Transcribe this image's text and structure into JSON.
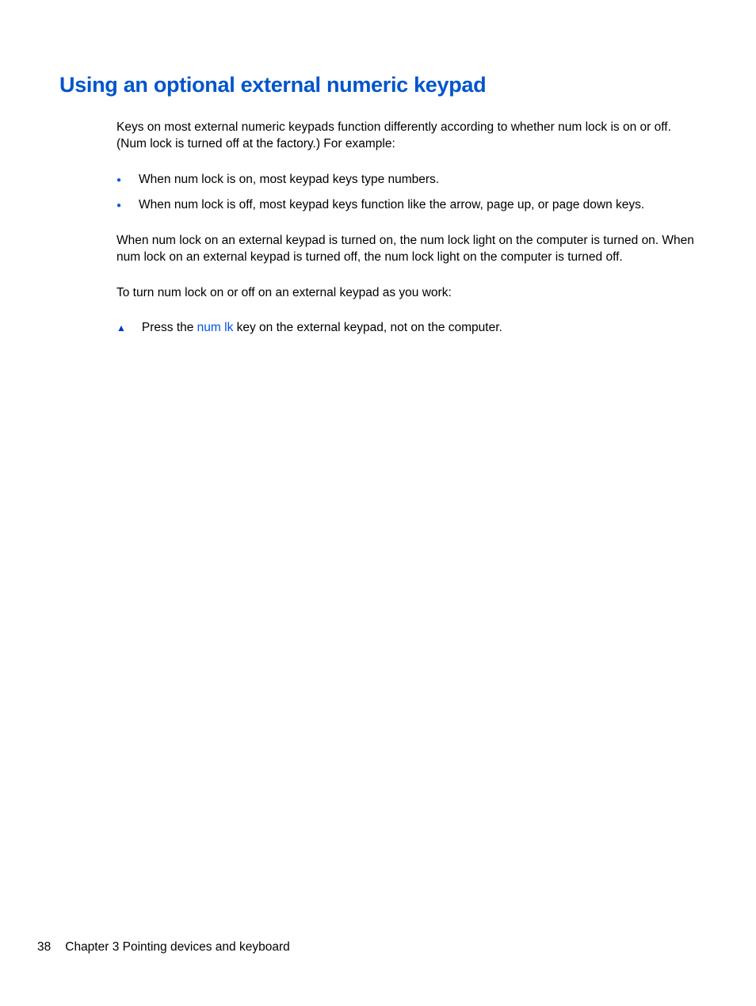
{
  "heading": "Using an optional external numeric keypad",
  "paragraph1": "Keys on most external numeric keypads function differently according to whether num lock is on or off. (Num lock is turned off at the factory.) For example:",
  "bullets": [
    "When num lock is on, most keypad keys type numbers.",
    "When num lock is off, most keypad keys function like the arrow, page up, or page down keys."
  ],
  "paragraph2": "When num lock on an external keypad is turned on, the num lock light on the computer is turned on. When num lock on an external keypad is turned off, the num lock light on the computer is turned off.",
  "paragraph3": "To turn num lock on or off on an external keypad as you work:",
  "step": {
    "prefix": "Press the ",
    "key": "num lk",
    "suffix": " key on the external keypad, not on the computer."
  },
  "footer": {
    "pageNumber": "38",
    "chapterLabel": "Chapter 3   Pointing devices and keyboard"
  }
}
